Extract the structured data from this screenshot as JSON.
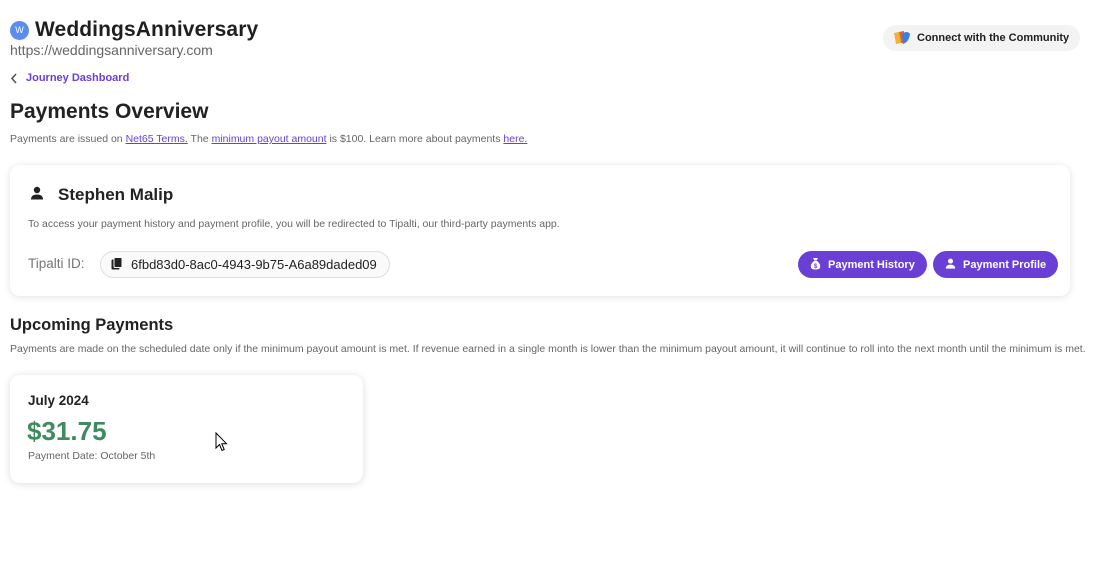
{
  "site": {
    "logo_letter": "W",
    "name": "WeddingsAnniversary",
    "url": "https://weddingsanniversary.com"
  },
  "community_button": {
    "label": "Connect with the Community",
    "icon": "community-logo-icon"
  },
  "back_link": {
    "label": "Journey Dashboard",
    "icon": "chevron-left-icon"
  },
  "page": {
    "title": "Payments Overview",
    "intro": {
      "part1": "Payments are issued on ",
      "link_terms": "Net65 Terms.",
      "part2": " The ",
      "link_minimum": "minimum payout amount",
      "part3": " is $100. Learn more about payments ",
      "link_here": "here."
    }
  },
  "profile_card": {
    "user_icon": "person-icon",
    "user_name": "Stephen Malip",
    "redirect_note": "To access your payment history and payment profile, you will be redirected to Tipalti, our third-party payments app.",
    "tipalti_label": "Tipalti ID:",
    "tipalti_id": "6fbd83d0-8ac0-4943-9b75-A6a89daded09",
    "copy_icon": "copy-icon",
    "history_button": "Payment History",
    "profile_button": "Payment Profile"
  },
  "upcoming": {
    "title": "Upcoming Payments",
    "note": "Payments are made on the scheduled date only if the minimum payout amount is met. If revenue earned in a single month is lower than the minimum payout amount, it will continue to roll into the next month until the minimum is met.",
    "payments": [
      {
        "month": "July 2024",
        "amount": "$31.75",
        "date": "Payment Date: October 5th"
      }
    ]
  },
  "colors": {
    "accent": "#6a3fd6",
    "amount_green": "#3f8a5e"
  }
}
